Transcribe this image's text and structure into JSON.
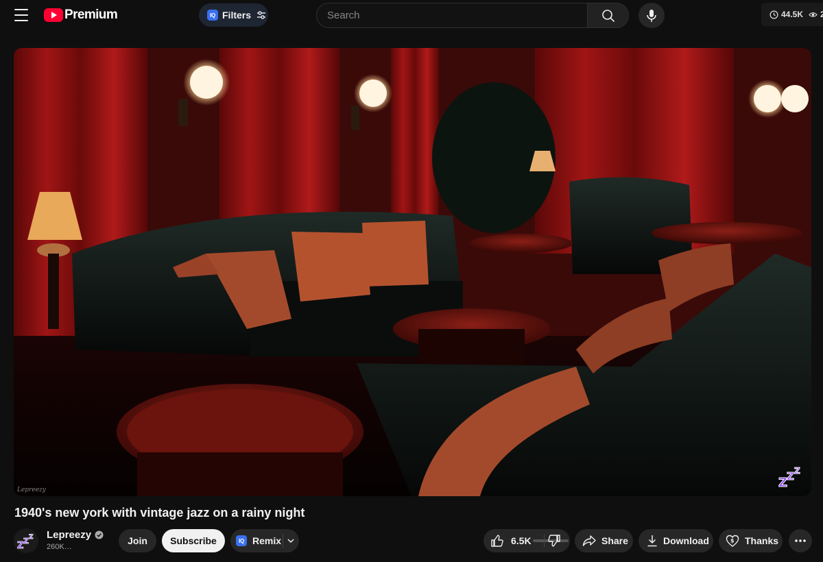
{
  "header": {
    "logo_text": "Premium",
    "filters": {
      "badge": "IQ",
      "label": "Filters"
    },
    "search": {
      "placeholder": "Search",
      "value": ""
    },
    "stats": {
      "views_value": "44.5K",
      "watching_value": "2"
    }
  },
  "player": {
    "watermark": "Lepreezy"
  },
  "video": {
    "title": "1940's new york with vintage jazz on a rainy night"
  },
  "channel": {
    "name": "Lepreezy",
    "subscribers": "260K…",
    "avatar_icon": "zzz-icon"
  },
  "actions": {
    "join": "Join",
    "subscribe": "Subscribe",
    "remix": {
      "badge": "IQ",
      "label": "Remix"
    },
    "likes": "6.5K",
    "like_ratio": 0.0,
    "share": "Share",
    "download": "Download",
    "thanks": "Thanks"
  },
  "colors": {
    "accent_red": "#ff0033",
    "iq_blue": "#3a6ff0",
    "channel_purple": "#8a3df0",
    "background": "#0f0f0f"
  }
}
